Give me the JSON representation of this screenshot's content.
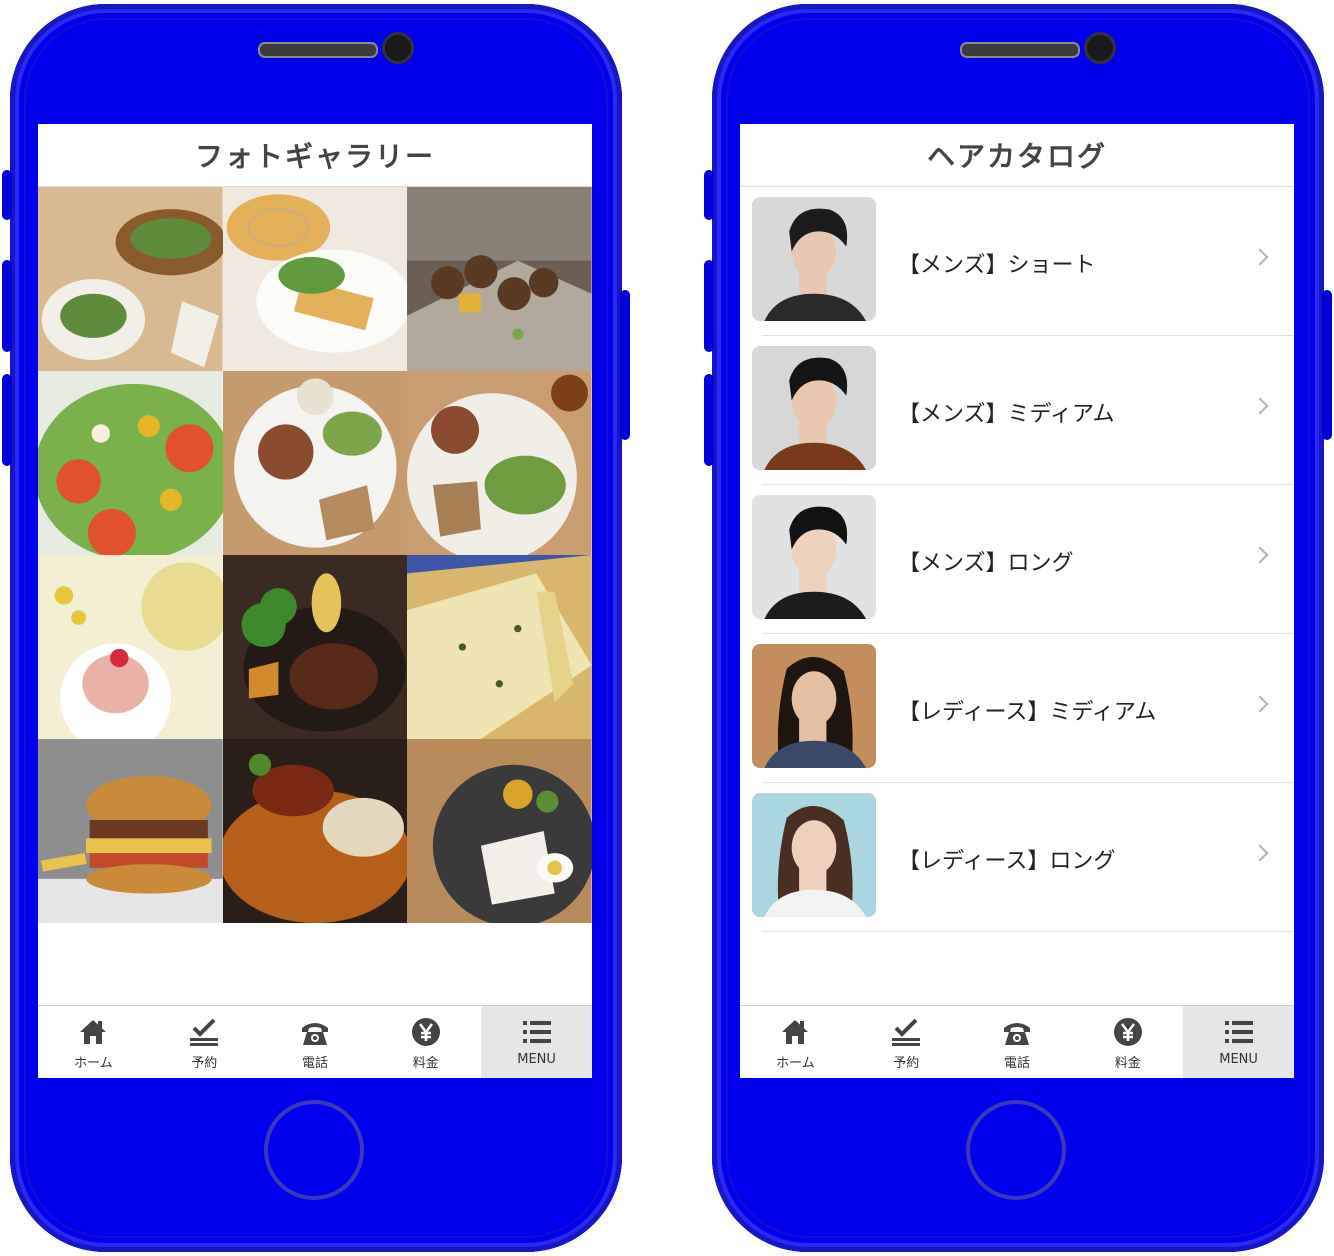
{
  "left_phone": {
    "title": "フォトギャラリー",
    "photos": [
      {
        "name": "photo-sandwich-salad-plate",
        "colors": [
          "#d9b98f",
          "#f2efe9",
          "#8b5a2b",
          "#5e8c3b"
        ]
      },
      {
        "name": "photo-quiche-salad-plate",
        "colors": [
          "#efe9df",
          "#e2b15a",
          "#5f9a3e",
          "#c9ad86"
        ]
      },
      {
        "name": "photo-kebab-skewers",
        "colors": [
          "#6b5f55",
          "#5b3a22",
          "#e0b23a",
          "#7ca54a"
        ]
      },
      {
        "name": "photo-vegetable-salad",
        "colors": [
          "#e7ece3",
          "#79b14a",
          "#e3502c",
          "#e7b628"
        ]
      },
      {
        "name": "photo-hamburg-plate-salad",
        "colors": [
          "#c79a6c",
          "#f4f3f0",
          "#8a4b2e",
          "#7da64a"
        ]
      },
      {
        "name": "photo-hamburg-plate-tea",
        "colors": [
          "#c99d70",
          "#f1eee8",
          "#8a4b2e",
          "#6e9c3e"
        ]
      },
      {
        "name": "photo-cupcake-tea",
        "colors": [
          "#f4eed2",
          "#e6d680",
          "#eab2a6",
          "#ffffff"
        ]
      },
      {
        "name": "photo-hamburg-steak-skillet",
        "colors": [
          "#3b2a22",
          "#3d8a2a",
          "#d28a2a",
          "#5a2a18"
        ]
      },
      {
        "name": "photo-cheese-pizza",
        "colors": [
          "#3e56a8",
          "#f0e3b4",
          "#d9b66e",
          "#e6d28a"
        ]
      },
      {
        "name": "photo-burger-fries",
        "colors": [
          "#8e8e8e",
          "#c98a3a",
          "#e9c24b",
          "#6a3a20"
        ]
      },
      {
        "name": "photo-curry-rice",
        "colors": [
          "#2a1e18",
          "#b55f1a",
          "#e3d7bd",
          "#7a2a14"
        ]
      },
      {
        "name": "photo-chicken-egg-bowl",
        "colors": [
          "#b98b5a",
          "#3a3a3a",
          "#f3efe8",
          "#e6c44a"
        ]
      }
    ],
    "tabs": [
      {
        "label": "ホーム",
        "icon": "home-icon"
      },
      {
        "label": "予約",
        "icon": "checkmark-icon"
      },
      {
        "label": "電話",
        "icon": "telephone-icon"
      },
      {
        "label": "料金",
        "icon": "yen-icon"
      },
      {
        "label": "MENU",
        "icon": "menu-list-icon",
        "active": true
      }
    ]
  },
  "right_phone": {
    "title": "ヘアカタログ",
    "items": [
      {
        "label": "【メンズ】ショート",
        "bg": "#d8d8d8",
        "hair": "#1c1c1c",
        "skin": "#e8c8b2",
        "shirt": "#2a2a2a"
      },
      {
        "label": "【メンズ】ミディアム",
        "bg": "#d7d7d7",
        "hair": "#151515",
        "skin": "#ebc7ad",
        "shirt": "#7a3a1a"
      },
      {
        "label": "【メンズ】ロング",
        "bg": "#e2e2e2",
        "hair": "#121212",
        "skin": "#efd2bd",
        "shirt": "#1c1c1c"
      },
      {
        "label": "【レディース】ミディアム",
        "bg": "#c48d5c",
        "hair": "#1e1410",
        "skin": "#e6bfa2",
        "shirt": "#3b4a6a"
      },
      {
        "label": "【レディース】ロング",
        "bg": "#a9d6e0",
        "hair": "#4a2e22",
        "skin": "#f0d0bd",
        "shirt": "#f3f3f3"
      }
    ],
    "tabs": [
      {
        "label": "ホーム",
        "icon": "home-icon"
      },
      {
        "label": "予約",
        "icon": "checkmark-icon"
      },
      {
        "label": "電話",
        "icon": "telephone-icon"
      },
      {
        "label": "料金",
        "icon": "yen-icon"
      },
      {
        "label": "MENU",
        "icon": "menu-list-icon",
        "active": true
      }
    ]
  },
  "colors": {
    "phone_body": "#0000ee",
    "tab_active_bg": "#e6e6e6",
    "title_text": "#444444"
  }
}
